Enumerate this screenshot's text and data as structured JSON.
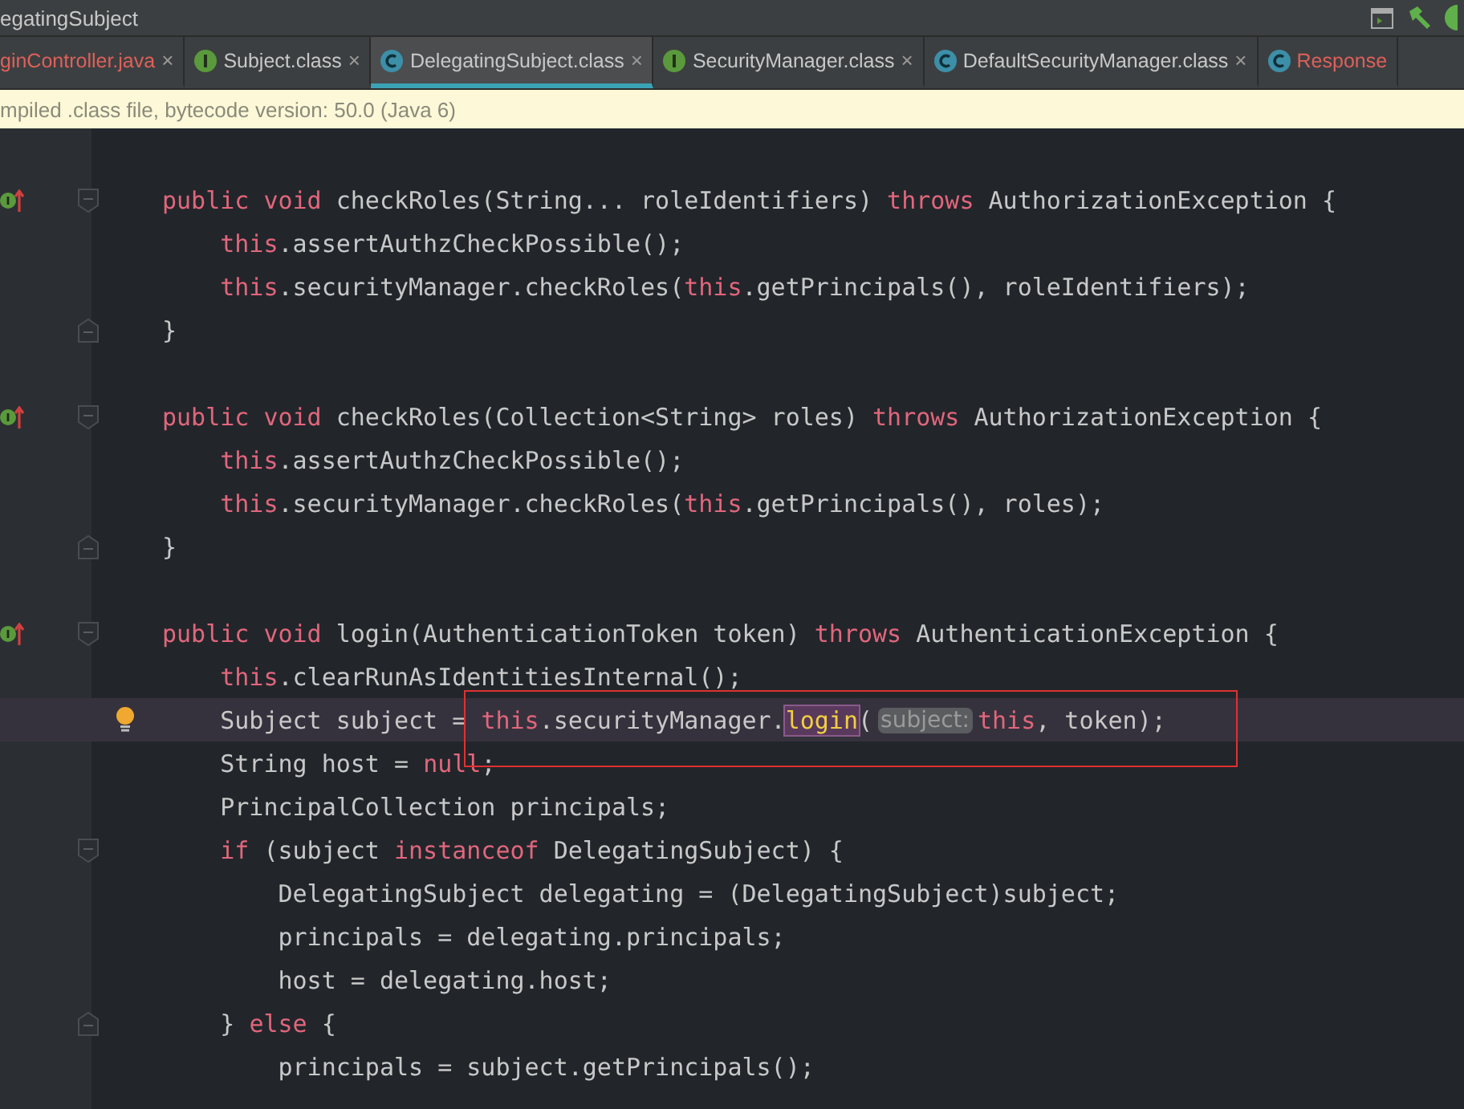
{
  "window": {
    "title": "egatingSubject"
  },
  "tabs": [
    {
      "label": "ginController.java",
      "kind": "plain",
      "color": "#e0605a",
      "selected": false,
      "close": "×"
    },
    {
      "label": "Subject.class",
      "kind": "interface",
      "color": "#c8c8c8",
      "selected": false,
      "close": "×"
    },
    {
      "label": "DelegatingSubject.class",
      "kind": "class",
      "color": "#c8c8c8",
      "selected": true,
      "close": "×"
    },
    {
      "label": "SecurityManager.class",
      "kind": "interface",
      "color": "#c8c8c8",
      "selected": false,
      "close": "×"
    },
    {
      "label": "DefaultSecurityManager.class",
      "kind": "class",
      "color": "#c8c8c8",
      "selected": false,
      "close": "×"
    },
    {
      "label": "Response",
      "kind": "class",
      "color": "#e0605a",
      "selected": false
    }
  ],
  "notice": "mpiled .class file, bytecode version: 50.0 (Java 6)",
  "lines": [
    {
      "current": false
    },
    {
      "current": false,
      "gutter": [
        {
          "kind": "implements"
        },
        {
          "kind": "fold_open"
        }
      ],
      "tokens": [
        {
          "kind": "keyword",
          "t": "public void "
        },
        {
          "kind": "plain",
          "t": "checkRoles(String... roleIdentifiers) "
        },
        {
          "kind": "keyword",
          "t": "throws "
        },
        {
          "kind": "plain",
          "t": "AuthorizationException {"
        }
      ]
    },
    {
      "current": false,
      "tokens": [
        {
          "kind": "keyword",
          "t": "    this"
        },
        {
          "kind": "plain",
          "t": ".assertAuthzCheckPossible();"
        }
      ]
    },
    {
      "current": false,
      "tokens": [
        {
          "kind": "keyword",
          "t": "    this"
        },
        {
          "kind": "plain",
          "t": ".securityManager.checkRoles("
        },
        {
          "kind": "keyword",
          "t": "this"
        },
        {
          "kind": "plain",
          "t": ".getPrincipals(), roleIdentifiers);"
        }
      ]
    },
    {
      "current": false,
      "gutter": [
        {
          "kind": "fold_close"
        }
      ],
      "tokens": [
        {
          "kind": "plain",
          "t": "}"
        }
      ]
    },
    {
      "current": false
    },
    {
      "current": false,
      "gutter": [
        {
          "kind": "implements"
        },
        {
          "kind": "fold_open"
        }
      ],
      "tokens": [
        {
          "kind": "keyword",
          "t": "public void "
        },
        {
          "kind": "plain",
          "t": "checkRoles(Collection<String> roles) "
        },
        {
          "kind": "keyword",
          "t": "throws "
        },
        {
          "kind": "plain",
          "t": "AuthorizationException {"
        }
      ]
    },
    {
      "current": false,
      "tokens": [
        {
          "kind": "keyword",
          "t": "    this"
        },
        {
          "kind": "plain",
          "t": ".assertAuthzCheckPossible();"
        }
      ]
    },
    {
      "current": false,
      "tokens": [
        {
          "kind": "keyword",
          "t": "    this"
        },
        {
          "kind": "plain",
          "t": ".securityManager.checkRoles("
        },
        {
          "kind": "keyword",
          "t": "this"
        },
        {
          "kind": "plain",
          "t": ".getPrincipals(), roles);"
        }
      ]
    },
    {
      "current": false,
      "gutter": [
        {
          "kind": "fold_close"
        }
      ],
      "tokens": [
        {
          "kind": "plain",
          "t": "}"
        }
      ]
    },
    {
      "current": false
    },
    {
      "current": false,
      "gutter": [
        {
          "kind": "implements"
        },
        {
          "kind": "fold_open"
        }
      ],
      "tokens": [
        {
          "kind": "keyword",
          "t": "public void "
        },
        {
          "kind": "plain",
          "t": "login(AuthenticationToken token) "
        },
        {
          "kind": "keyword",
          "t": "throws "
        },
        {
          "kind": "plain",
          "t": "AuthenticationException {"
        }
      ]
    },
    {
      "current": false,
      "tokens": [
        {
          "kind": "keyword",
          "t": "    this"
        },
        {
          "kind": "plain",
          "t": ".clearRunAsIdentitiesInternal();"
        }
      ]
    },
    {
      "current": true,
      "gutter": [
        {
          "kind": "bulb"
        }
      ],
      "tokens": [
        {
          "kind": "plain",
          "t": "    Subject subject = "
        },
        {
          "kind": "keyword",
          "t": "this"
        },
        {
          "kind": "plain",
          "t": ".securityManager."
        },
        {
          "kind": "match",
          "t": "login"
        },
        {
          "kind": "plain",
          "t": "("
        },
        {
          "kind": "hint",
          "t": "subject:"
        },
        {
          "kind": "keyword",
          "t": "this"
        },
        {
          "kind": "plain",
          "t": ", token);"
        }
      ]
    },
    {
      "current": false,
      "tokens": [
        {
          "kind": "plain",
          "t": "    String host = "
        },
        {
          "kind": "keyword",
          "t": "null"
        },
        {
          "kind": "plain",
          "t": ";"
        }
      ]
    },
    {
      "current": false,
      "tokens": [
        {
          "kind": "plain",
          "t": "    PrincipalCollection principals;"
        }
      ]
    },
    {
      "current": false,
      "gutter": [
        {
          "kind": "fold_open"
        }
      ],
      "tokens": [
        {
          "kind": "keyword",
          "t": "    if "
        },
        {
          "kind": "plain",
          "t": "(subject "
        },
        {
          "kind": "keyword",
          "t": "instanceof "
        },
        {
          "kind": "plain",
          "t": "DelegatingSubject) {"
        }
      ]
    },
    {
      "current": false,
      "tokens": [
        {
          "kind": "plain",
          "t": "        DelegatingSubject delegating = (DelegatingSubject)subject;"
        }
      ]
    },
    {
      "current": false,
      "tokens": [
        {
          "kind": "plain",
          "t": "        principals = delegating.principals;"
        }
      ]
    },
    {
      "current": false,
      "tokens": [
        {
          "kind": "plain",
          "t": "        host = delegating.host;"
        }
      ]
    },
    {
      "current": false,
      "gutter": [
        {
          "kind": "fold_close"
        }
      ],
      "tokens": [
        {
          "kind": "plain",
          "t": "    } "
        },
        {
          "kind": "keyword",
          "t": "else "
        },
        {
          "kind": "plain",
          "t": "{"
        }
      ]
    },
    {
      "current": false,
      "tokens": [
        {
          "kind": "plain",
          "t": "        principals = subject.getPrincipals();"
        }
      ]
    }
  ]
}
